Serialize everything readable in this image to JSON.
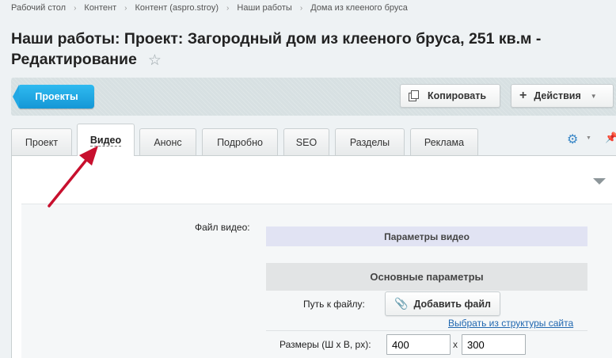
{
  "breadcrumb": [
    {
      "label": "Рабочий стол"
    },
    {
      "label": "Контент"
    },
    {
      "label": "Контент (aspro.stroy)"
    },
    {
      "label": "Наши работы"
    },
    {
      "label": "Дома из клееного бруса"
    }
  ],
  "title": "Наши работы: Проект: Загородный дом из клееного бруса, 251 кв.м - Редактирование",
  "toolbar": {
    "projects_label": "Проекты",
    "copy_label": "Копировать",
    "actions_label": "Действия"
  },
  "tabs": [
    {
      "label": "Проект"
    },
    {
      "label": "Видео"
    },
    {
      "label": "Анонс"
    },
    {
      "label": "Подробно"
    },
    {
      "label": "SEO"
    },
    {
      "label": "Разделы"
    },
    {
      "label": "Реклама"
    }
  ],
  "active_tab": "Видео",
  "form": {
    "file_label": "Файл видео:",
    "params_header": "Параметры видео",
    "basic_header": "Основные параметры",
    "path_label": "Путь к файлу:",
    "add_file_label": "Добавить файл",
    "structure_link": "Выбрать из структуры сайта",
    "size_label": "Размеры (Ш х В, px):",
    "width_value": "400",
    "times_sign": "x",
    "height_value": "300"
  },
  "colors": {
    "accent_button": "#1fa8e6",
    "link": "#2067b0",
    "annotation_arrow": "#c8102e"
  },
  "icons": [
    "star-icon",
    "copy-icon",
    "plus-icon",
    "gear-icon",
    "pin-icon",
    "paperclip-icon",
    "collapse-icon"
  ]
}
